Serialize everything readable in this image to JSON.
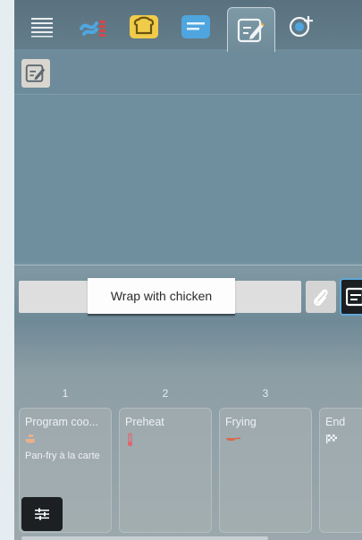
{
  "colors": {
    "accent": "#5fa9d8",
    "tab_blue": "#4fa6df",
    "tab_yellow": "#f0cc4a"
  },
  "tabs": [
    {
      "icon": "menu-icon"
    },
    {
      "icon": "cooking-steam-icon"
    },
    {
      "icon": "bread-icon"
    },
    {
      "icon": "list-card-icon"
    },
    {
      "icon": "edit-note-icon",
      "active": true
    },
    {
      "icon": "cycle-add-icon"
    }
  ],
  "program": {
    "name": "Wrap with chicken"
  },
  "steps": [
    {
      "number": "1",
      "title": "Program coo...",
      "icon": "pan-icon",
      "subtitle": "Pan-fry à la carte"
    },
    {
      "number": "2",
      "title": "Preheat",
      "icon": "thermometer-icon",
      "subtitle": ""
    },
    {
      "number": "3",
      "title": "Frying",
      "icon": "frying-pan-icon",
      "subtitle": ""
    },
    {
      "number": "",
      "title": "End",
      "icon": "finish-flag-icon",
      "subtitle": ""
    }
  ]
}
